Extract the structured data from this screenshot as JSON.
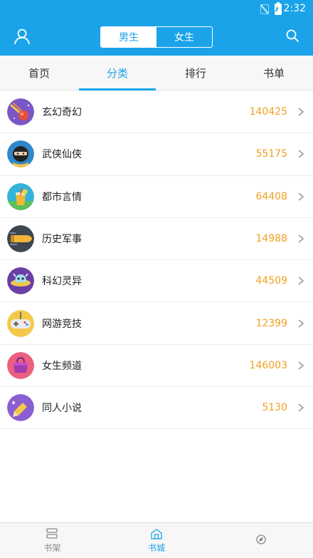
{
  "status_bar": {
    "time": "2:32"
  },
  "header": {
    "gender_tabs": [
      {
        "label": "男生",
        "selected": true
      },
      {
        "label": "女生",
        "selected": false
      }
    ]
  },
  "tabs": [
    {
      "label": "首页",
      "selected": false
    },
    {
      "label": "分类",
      "selected": true
    },
    {
      "label": "排行",
      "selected": false
    },
    {
      "label": "书单",
      "selected": false
    }
  ],
  "categories": [
    {
      "name": "玄幻奇幻",
      "count": "140425",
      "icon": "comet-icon"
    },
    {
      "name": "武侠仙侠",
      "count": "55175",
      "icon": "ninja-icon"
    },
    {
      "name": "都市言情",
      "count": "64408",
      "icon": "drink-icon"
    },
    {
      "name": "历史军事",
      "count": "14988",
      "icon": "bullet-icon"
    },
    {
      "name": "科幻灵异",
      "count": "44509",
      "icon": "ufo-icon"
    },
    {
      "name": "网游竞技",
      "count": "12399",
      "icon": "gamepad-icon"
    },
    {
      "name": "女生频道",
      "count": "146003",
      "icon": "handbag-icon"
    },
    {
      "name": "同人小说",
      "count": "5130",
      "icon": "pencil-icon"
    }
  ],
  "bottom_nav": [
    {
      "label": "书架",
      "selected": false
    },
    {
      "label": "书城",
      "selected": true
    },
    {
      "label": "",
      "selected": false
    }
  ],
  "colors": {
    "accent": "#1aa3e8",
    "count": "#f0a020"
  }
}
